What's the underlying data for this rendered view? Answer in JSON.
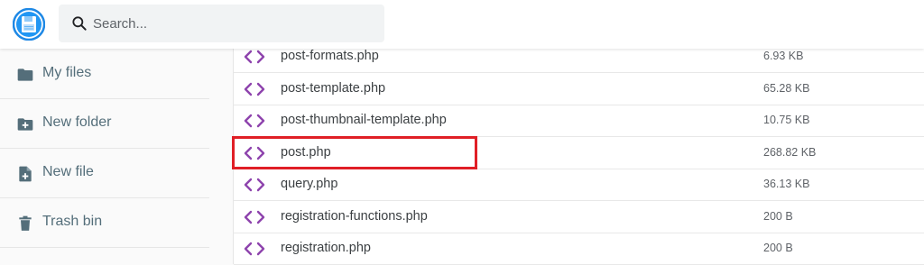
{
  "header": {
    "search_placeholder": "Search..."
  },
  "sidebar": {
    "items": [
      {
        "label": "My files",
        "icon": "folder-icon"
      },
      {
        "label": "New folder",
        "icon": "create-new-folder-icon"
      },
      {
        "label": "New file",
        "icon": "note-add-icon"
      },
      {
        "label": "Trash bin",
        "icon": "delete-icon"
      }
    ]
  },
  "files": [
    {
      "name": "post-formats.php",
      "size": "6.93 KB"
    },
    {
      "name": "post-template.php",
      "size": "65.28 KB"
    },
    {
      "name": "post-thumbnail-template.php",
      "size": "10.75 KB"
    },
    {
      "name": "post.php",
      "size": "268.82 KB",
      "highlighted": true
    },
    {
      "name": "query.php",
      "size": "36.13 KB"
    },
    {
      "name": "registration-functions.php",
      "size": "200 B"
    },
    {
      "name": "registration.php",
      "size": "200 B"
    }
  ],
  "colors": {
    "accent": "#1e88e5",
    "code_icon": "#8e44ad",
    "highlight_border": "#e01f26",
    "sidebar_text": "#546e7a"
  }
}
